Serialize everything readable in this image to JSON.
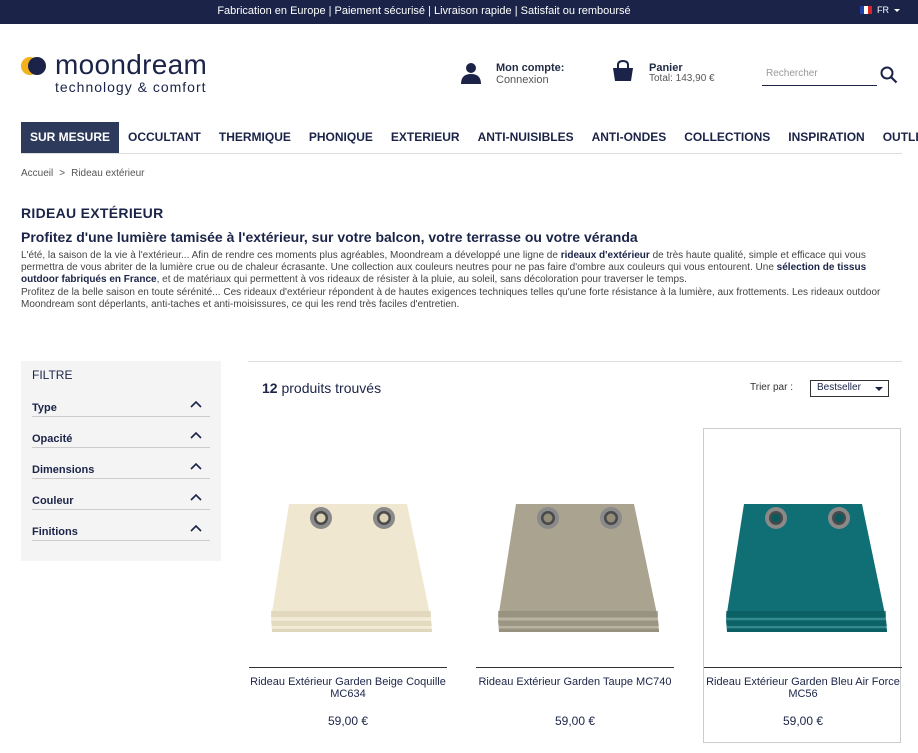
{
  "topbar": {
    "message": "Fabrication en Europe | Paiement sécurisé | Livraison rapide | Satisfait ou remboursé",
    "lang": "FR"
  },
  "logo": {
    "name": "moondream",
    "tagline": "technology & comfort"
  },
  "account": {
    "title": "Mon compte:",
    "action": "Connexion"
  },
  "cart": {
    "title": "Panier",
    "total": "Total: 143,90 €"
  },
  "search": {
    "placeholder": "Rechercher"
  },
  "nav": [
    {
      "label": "SUR MESURE",
      "active": true
    },
    {
      "label": "OCCULTANT"
    },
    {
      "label": "THERMIQUE"
    },
    {
      "label": "PHONIQUE"
    },
    {
      "label": "EXTERIEUR"
    },
    {
      "label": "ANTI-NUISIBLES"
    },
    {
      "label": "ANTI-ONDES"
    },
    {
      "label": "COLLECTIONS"
    },
    {
      "label": "INSPIRATION"
    },
    {
      "label": "OUTLET"
    }
  ],
  "breadcrumb": {
    "home": "Accueil",
    "separator": ">",
    "current": "Rideau extérieur"
  },
  "page": {
    "title": "RIDEAU EXTÉRIEUR",
    "subtitle": "Profitez d'une lumière tamisée à l'extérieur, sur votre balcon, votre terrasse ou votre véranda",
    "desc": {
      "p1a": "L'été, la saison de la vie à l'extérieur... Afin de rendre ces moments plus agréables, Moondream a développé une ligne de ",
      "p1b": "rideaux d'extérieur",
      "p1c": " de très haute qualité, simple et efficace qui vous permettra de vous abriter de la lumière crue ou de chaleur écrasante. Une collection aux couleurs neutres pour ne pas faire d'ombre aux couleurs qui vous entourent. Une ",
      "p1d": "sélection de tissus outdoor fabriqués en France",
      "p1e": ", et de matériaux qui permettent à vos rideaux de résister à la pluie, au soleil, sans décoloration pour traverser le temps.",
      "p2": "Profitez de la belle saison en toute sérénité... Ces rideaux d'extérieur répondent à de hautes exigences techniques telles qu'une forte résistance à la lumière, aux frottements. Les rideaux outdoor Moondream sont déperlants, anti-taches et anti-moisissures, ce qui les rend très faciles d'entretien."
    }
  },
  "filter": {
    "title": "FILTRE",
    "items": [
      "Type",
      "Opacité",
      "Dimensions",
      "Couleur",
      "Finitions"
    ]
  },
  "results": {
    "count": "12",
    "count_label": "produits trouvés",
    "sort_label": "Trier par :",
    "sort_value": "Bestseller"
  },
  "products": [
    {
      "name": "Rideau Extérieur Garden Beige Coquille MC634",
      "price": "59,00 €",
      "color": "#efe7cf",
      "shade": "#dcd2b6"
    },
    {
      "name": "Rideau Extérieur Garden Taupe MC740",
      "price": "59,00 €",
      "color": "#a9a38f",
      "shade": "#928c79"
    },
    {
      "name": "Rideau Extérieur Garden Bleu Air Force MC56",
      "price": "59,00 €",
      "color": "#0f6f74",
      "shade": "#0a5a5e"
    }
  ]
}
